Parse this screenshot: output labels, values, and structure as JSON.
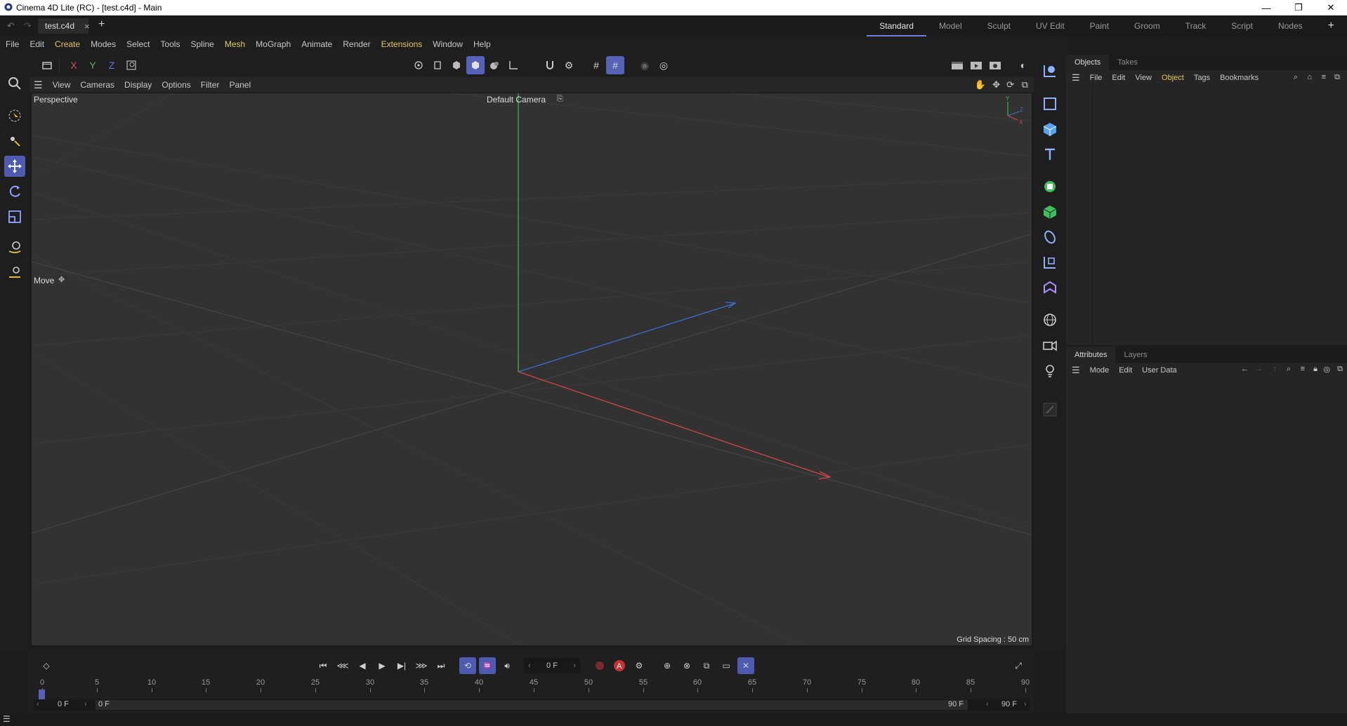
{
  "window": {
    "title": "Cinema 4D Lite (RC) - [test.c4d] - Main",
    "controls": [
      "minimize-icon",
      "restore-icon",
      "close-icon"
    ]
  },
  "doc_tabs": {
    "active_tab": "test.c4d",
    "close_symbol": "×",
    "add_symbol": "+"
  },
  "layouts": {
    "items": [
      "Standard",
      "Model",
      "Sculpt",
      "UV Edit",
      "Paint",
      "Groom",
      "Track",
      "Script",
      "Nodes"
    ],
    "active": "Standard",
    "add_symbol": "+"
  },
  "menu": {
    "items": [
      "File",
      "Edit",
      "Create",
      "Modes",
      "Select",
      "Tools",
      "Spline",
      "Mesh",
      "MoGraph",
      "Animate",
      "Render",
      "Extensions",
      "Window",
      "Help"
    ],
    "highlighted": [
      "Create",
      "Mesh",
      "Extensions"
    ]
  },
  "axis_lock": {
    "x": "X",
    "y": "Y",
    "z": "Z"
  },
  "viewport": {
    "menu": [
      "View",
      "Cameras",
      "Display",
      "Options",
      "Filter",
      "Panel"
    ],
    "projection": "Perspective",
    "camera": "Default Camera",
    "tool_label": "Move",
    "grid_spacing": "Grid Spacing : 50 cm",
    "axis_gizmo": {
      "x": "X",
      "y": "Y",
      "z": "Z"
    }
  },
  "objects_panel": {
    "tabs": [
      "Objects",
      "Takes"
    ],
    "active_tab": "Objects",
    "menu": [
      "File",
      "Edit",
      "View",
      "Object",
      "Tags",
      "Bookmarks"
    ],
    "highlighted_menu": "Object"
  },
  "attributes_panel": {
    "tabs": [
      "Attributes",
      "Layers"
    ],
    "active_tab": "Attributes",
    "menu": [
      "Mode",
      "Edit",
      "User Data"
    ]
  },
  "timeline": {
    "current_frame": "0 F",
    "ruler_labels": [
      "0",
      "5",
      "10",
      "15",
      "20",
      "25",
      "30",
      "35",
      "40",
      "45",
      "50",
      "55",
      "60",
      "65",
      "70",
      "75",
      "80",
      "85",
      "90"
    ],
    "range_start": "0 F",
    "range_inner_start": "0 F",
    "range_inner_end": "90 F",
    "range_end": "90 F",
    "autokey_label": "A"
  },
  "colors": {
    "accent": "#5562b8",
    "active_layout_underline": "#6f7fd6",
    "menu_highlight": "#e0c864",
    "axis_x": "#d04848",
    "axis_y": "#3fae5a",
    "axis_z": "#3a6fcf",
    "viewport_bg": "#323232"
  }
}
